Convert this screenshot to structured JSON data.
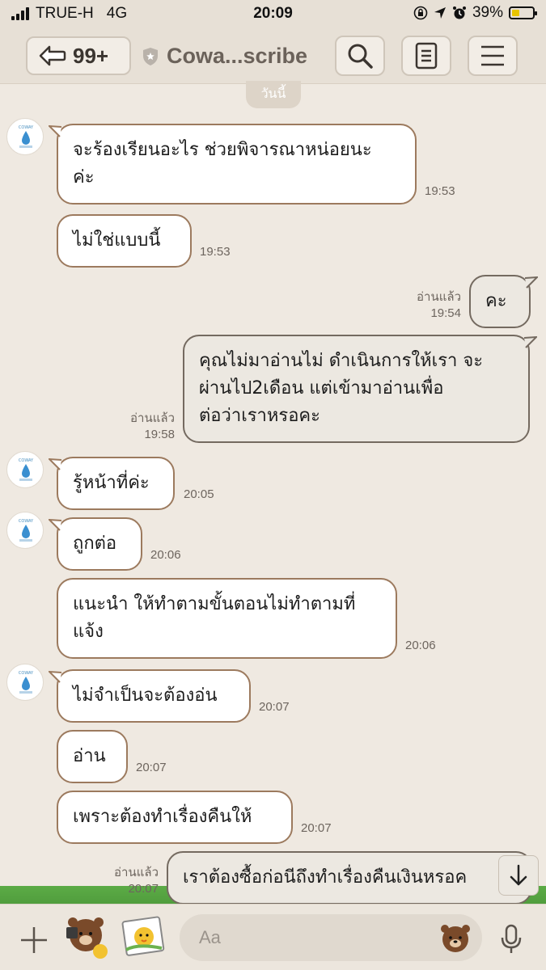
{
  "status_bar": {
    "carrier": "TRUE-H",
    "network": "4G",
    "time": "20:09",
    "battery_percent": "39%",
    "battery_level": 0.39
  },
  "header": {
    "back_badge": "99+",
    "title": "Cowa...scribe"
  },
  "date_label": "วันนี้",
  "messages": [
    {
      "side": "in",
      "lines": [
        "จะร้องเรียนอะไร ช่วยพิจารณาหน่อยนะ",
        "ค่ะ"
      ],
      "time": "19:53"
    },
    {
      "side": "in",
      "lines": [
        "ไม่ใช่แบบนี้"
      ],
      "time": "19:53"
    },
    {
      "side": "out",
      "lines": [
        "คะ"
      ],
      "read": "อ่านแล้ว",
      "time": "19:54"
    },
    {
      "side": "out",
      "lines": [
        "คุณไม่มาอ่านไม่ ดำเนินการให้เรา จะ",
        "ผ่านไป2เดือน   แต่เข้ามาอ่านเพื่อ",
        "ต่อว่าเราหรอคะ"
      ],
      "read": "อ่านแล้ว",
      "time": "19:58"
    },
    {
      "side": "in",
      "lines": [
        "รู้หน้าที่ค่ะ"
      ],
      "time": "20:05"
    },
    {
      "side": "in",
      "lines": [
        "ถูกต่อ"
      ],
      "time": "20:06"
    },
    {
      "side": "in",
      "lines": [
        "แนะนำ ให้ทำตามขั้นตอนไม่ทำตามที่",
        "แจ้ง"
      ],
      "time": "20:06"
    },
    {
      "side": "in",
      "lines": [
        "ไม่จำเป็นจะต้องอ่น"
      ],
      "time": "20:07"
    },
    {
      "side": "in",
      "lines": [
        "อ่าน"
      ],
      "time": "20:07"
    },
    {
      "side": "in",
      "lines": [
        "เพราะต้องทำเรื่องคืนให้"
      ],
      "time": "20:07"
    },
    {
      "side": "out",
      "lines": [
        "เราต้องซื้อก่อนีถึงทำเรื่องคืนเงินหรอค"
      ],
      "read": "อ่านแล้ว",
      "time": "20:07"
    }
  ],
  "input": {
    "placeholder": "Aa"
  },
  "icons": {
    "back": "back-arrow-icon",
    "shield": "shield-icon",
    "search": "search-icon",
    "notes": "notes-icon",
    "menu": "menu-icon",
    "plus": "plus-icon",
    "mic": "microphone-icon",
    "scroll": "arrow-down-icon"
  },
  "colors": {
    "background": "#efe9e1",
    "bubble_in_border": "#9c7a5e",
    "bubble_out_bg": "#ece8e1",
    "battery": "#e8c400",
    "grass": "#5cab46"
  }
}
